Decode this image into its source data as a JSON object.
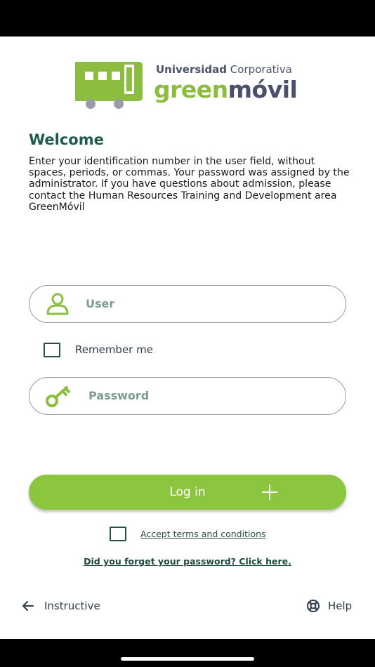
{
  "brand": {
    "top_bold": "Universidad",
    "top_regular": "Corporativa",
    "main_green": "green",
    "main_slate": "móvil",
    "green_color": "#8cbd3f",
    "slate_color": "#4a4f6b"
  },
  "welcome": {
    "title": "Welcome",
    "body": "Enter your identification number in the user field, without spaces, periods, or commas. Your password was assigned by the administrator. If you have questions about admission, please contact the Human Resources Training and Development area GreenMóvil"
  },
  "form": {
    "user_placeholder": "User",
    "user_value": "",
    "remember_label": "Remember me",
    "remember_checked": false,
    "password_placeholder": "Password",
    "password_value": "",
    "login_label": "Log in",
    "terms_label": "Accept terms and conditions",
    "terms_checked": false,
    "forgot_label": "Did you forget your password? Click here."
  },
  "footer": {
    "instructive_label": "Instructive",
    "help_label": "Help"
  },
  "icons": {
    "user": "user-icon",
    "password": "key-icon",
    "login": "plus-icon",
    "instructive": "arrow-left-icon",
    "help": "lifebuoy-icon"
  },
  "colors": {
    "accent": "#8cc63f",
    "heading": "#1f5a4c",
    "checkbox_border": "#2a4f45"
  }
}
